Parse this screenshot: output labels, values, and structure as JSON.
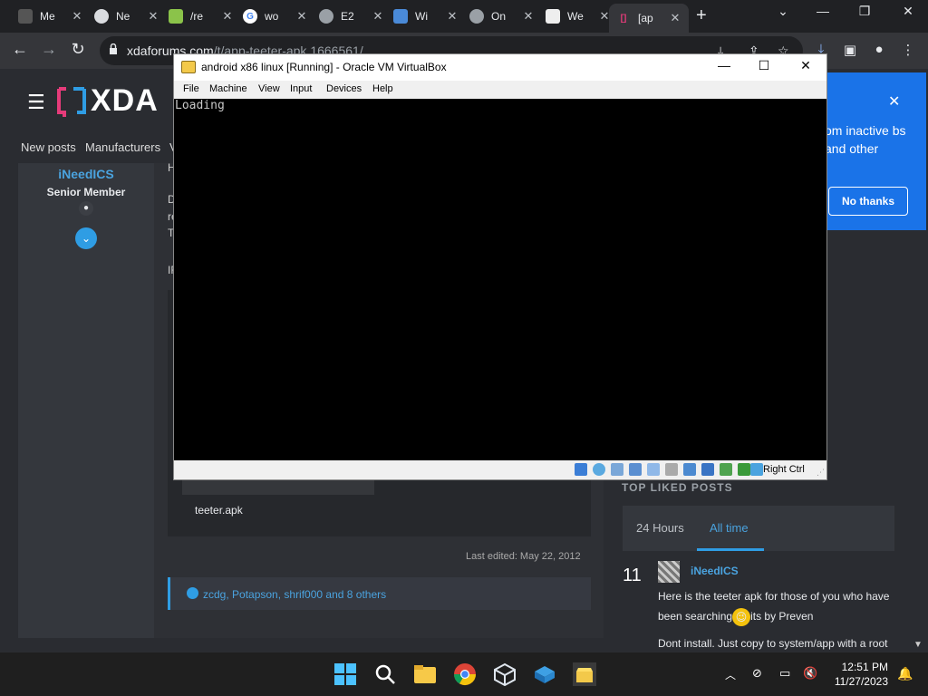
{
  "browser": {
    "tabs": [
      {
        "label": "Me",
        "icon": "monitor-icon"
      },
      {
        "label": "Ne",
        "icon": "chrome-icon"
      },
      {
        "label": "/re",
        "icon": "flag-icon"
      },
      {
        "label": "wo",
        "icon": "google-icon"
      },
      {
        "label": "E2",
        "icon": "globe-icon"
      },
      {
        "label": "Wi",
        "icon": "wiki-icon"
      },
      {
        "label": "On",
        "icon": "globe-icon"
      },
      {
        "label": "We",
        "icon": "figure-icon"
      },
      {
        "label": "[ap",
        "icon": "xda-icon"
      }
    ],
    "url_host": "xdaforums.com",
    "url_path": "/t/app-teeter-apk.1666561/"
  },
  "site": {
    "logo": "XDA",
    "nav": [
      "New posts",
      "Manufacturers",
      "V"
    ],
    "user": {
      "name": "iNeedICS",
      "title": "Senior Member"
    },
    "post_fragments": [
      "H",
      "D",
      "re",
      "T",
      "IF"
    ],
    "attachment_name": "teeter.apk",
    "last_edited": "Last edited: May 22, 2012",
    "likes": "zcdg, Potapson, shrif000 and 8 others",
    "top_liked": {
      "title": "TOP LIKED POSTS",
      "tabs": [
        "24 Hours",
        "All time"
      ],
      "active_tab": "All time",
      "count": "11",
      "author": "iNeedICS",
      "text_before_emoji": "Here is the teeter apk for those of you who have been searching",
      "text_after_emoji": "its by Preven",
      "text2": "Dont install. Just copy to system/app with a root"
    },
    "popup": {
      "text": "om inactive bs and other",
      "button": "No thanks"
    }
  },
  "vbox": {
    "title": "android x86 linux [Running] - Oracle VM VirtualBox",
    "menu": [
      "File",
      "Machine",
      "View",
      "Input",
      "Devices",
      "Help"
    ],
    "console": "Loading",
    "host_key": "Right Ctrl"
  },
  "taskbar": {
    "time": "12:51 PM",
    "date": "11/27/2023"
  },
  "colors": {
    "accent": "#1a73e8",
    "xda_blue": "#2f9de4",
    "xda_pink": "#e63b7a"
  }
}
